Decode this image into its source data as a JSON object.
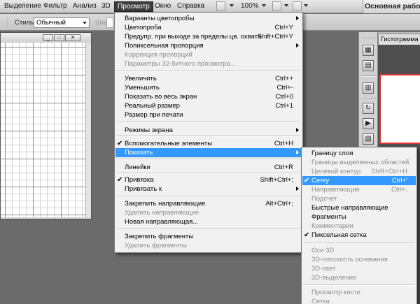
{
  "menubar": {
    "items": [
      "Выделение",
      "Фильтр",
      "Анализ",
      "3D",
      "Просмотр",
      "Окно",
      "Справка"
    ],
    "zoom": "100%",
    "workspace": "Основная рабоча"
  },
  "options_bar": {
    "style_label": "Стиль:",
    "style_value": "Обычный",
    "width_label": "Шир.:"
  },
  "panel": {
    "tab_label": "Гистограмма"
  },
  "view_menu": {
    "items": [
      {
        "label": "Варианты цветопробы",
        "shortcut": "",
        "submenu": true,
        "disabled": false
      },
      {
        "label": "Цветопроба",
        "shortcut": "Ctrl+Y"
      },
      {
        "label": "Предупр. при выходе за пределы цв. охвата",
        "shortcut": "Shift+Ctrl+Y"
      },
      {
        "label": "Попиксельная пропорция",
        "shortcut": "",
        "submenu": true
      },
      {
        "label": "Коррекция пропорций",
        "shortcut": "",
        "disabled": true
      },
      {
        "label": "Параметры 32-битного просмотра...",
        "shortcut": "",
        "disabled": true
      },
      {
        "label": "Увеличить",
        "shortcut": "Ctrl++"
      },
      {
        "label": "Уменьшить",
        "shortcut": "Ctrl+-"
      },
      {
        "label": "Показать во весь экран",
        "shortcut": "Ctrl+0"
      },
      {
        "label": "Реальный размер",
        "shortcut": "Ctrl+1"
      },
      {
        "label": "Размер при печати",
        "shortcut": ""
      },
      {
        "label": "Режимы экрана",
        "shortcut": "",
        "submenu": true
      },
      {
        "label": "Вспомогательные элементы",
        "shortcut": "Ctrl+H",
        "checked": true
      },
      {
        "label": "Показать",
        "shortcut": "",
        "submenu": true,
        "highlighted": true
      },
      {
        "label": "Линейки",
        "shortcut": "Ctrl+R"
      },
      {
        "label": "Привязка",
        "shortcut": "Shift+Ctrl+;",
        "checked": true
      },
      {
        "label": "Привязать к",
        "shortcut": "",
        "submenu": true
      },
      {
        "label": "Закрепить направляющие",
        "shortcut": "Alt+Ctrl+;"
      },
      {
        "label": "Удалить направляющие",
        "shortcut": "",
        "disabled": true
      },
      {
        "label": "Новая направляющая...",
        "shortcut": ""
      },
      {
        "label": "Закрепить фрагменты",
        "shortcut": ""
      },
      {
        "label": "Удалить фрагменты",
        "shortcut": "",
        "disabled": true
      }
    ]
  },
  "show_menu": {
    "items": [
      {
        "label": "Границу слоя",
        "shortcut": ""
      },
      {
        "label": "Границы выделенных областей",
        "shortcut": "",
        "disabled": true
      },
      {
        "label": "Целевой контур",
        "shortcut": "Shift+Ctrl+H",
        "disabled": true
      },
      {
        "label": "Сетку",
        "shortcut": "Ctrl+'",
        "checked": true,
        "highlighted": true
      },
      {
        "label": "Направляющие",
        "shortcut": "Ctrl+;",
        "disabled": true
      },
      {
        "label": "Подсчет",
        "shortcut": "",
        "disabled": true
      },
      {
        "label": "Быстрые направляющие",
        "shortcut": ""
      },
      {
        "label": "Фрагменты",
        "shortcut": ""
      },
      {
        "label": "Комментарии",
        "shortcut": "",
        "disabled": true
      },
      {
        "label": "Пиксельная сетка",
        "shortcut": "",
        "checked": true
      },
      {
        "label": "Оси 3D",
        "shortcut": "",
        "disabled": true
      },
      {
        "label": "3D-плоскость основания",
        "shortcut": "",
        "disabled": true
      },
      {
        "label": "3D-свет",
        "shortcut": "",
        "disabled": true
      },
      {
        "label": "3D-выделение",
        "shortcut": "",
        "disabled": true
      },
      {
        "label": "Просмотр кисти",
        "shortcut": "",
        "disabled": true
      },
      {
        "label": "Сетка",
        "shortcut": "",
        "disabled": true
      }
    ]
  },
  "colors": {
    "highlight": "#3399ff",
    "menu_bg": "#f1f1f1",
    "workspace_bg": "#6b6b6b"
  }
}
